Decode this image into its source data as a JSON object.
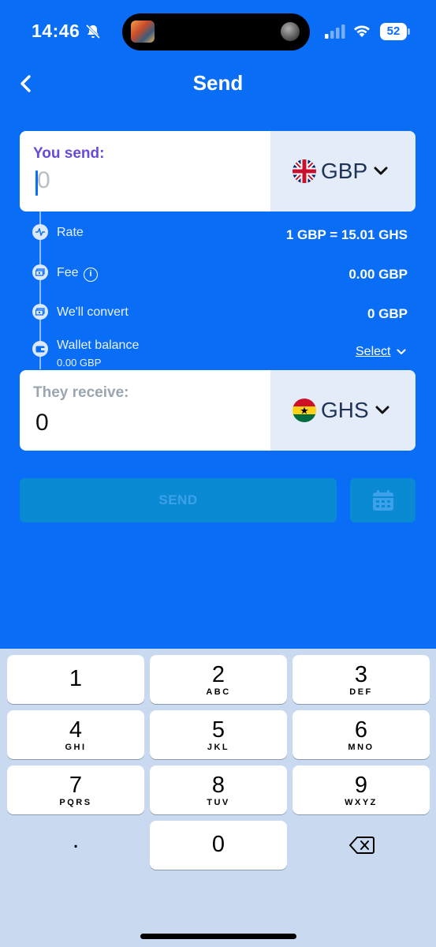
{
  "status_bar": {
    "time": "14:46",
    "battery": "52"
  },
  "header": {
    "title": "Send"
  },
  "send_card": {
    "label": "You send:",
    "placeholder": "0",
    "currency": "GBP"
  },
  "info_rows": {
    "rate": {
      "label": "Rate",
      "value": "1 GBP = 15.01 GHS"
    },
    "fee": {
      "label": "Fee",
      "value": "0.00 GBP",
      "info": "i"
    },
    "convert": {
      "label": "We'll convert",
      "value": "0 GBP"
    },
    "wallet": {
      "label": "Wallet balance",
      "sub": "0.00 GBP",
      "action": "Select"
    }
  },
  "receive_card": {
    "label": "They receive:",
    "value": "0",
    "currency": "GHS"
  },
  "actions": {
    "send_label": "SEND"
  },
  "keypad": {
    "keys": [
      {
        "num": "1",
        "letters": ""
      },
      {
        "num": "2",
        "letters": "ABC"
      },
      {
        "num": "3",
        "letters": "DEF"
      },
      {
        "num": "4",
        "letters": "GHI"
      },
      {
        "num": "5",
        "letters": "JKL"
      },
      {
        "num": "6",
        "letters": "MNO"
      },
      {
        "num": "7",
        "letters": "PQRS"
      },
      {
        "num": "8",
        "letters": "TUV"
      },
      {
        "num": "9",
        "letters": "WXYZ"
      },
      {
        "num": "0",
        "letters": ""
      }
    ],
    "dot": "."
  },
  "icons": {
    "back": "chevron-left-icon",
    "bell": "bell-slash-icon",
    "calendar": "calendar-icon",
    "delete": "backspace-icon"
  },
  "colors": {
    "background": "#0A6DF6",
    "accent_label": "#6A4BD8",
    "button_disabled": "#0A8AD3",
    "keypad_bg": "#C9DAF0"
  }
}
